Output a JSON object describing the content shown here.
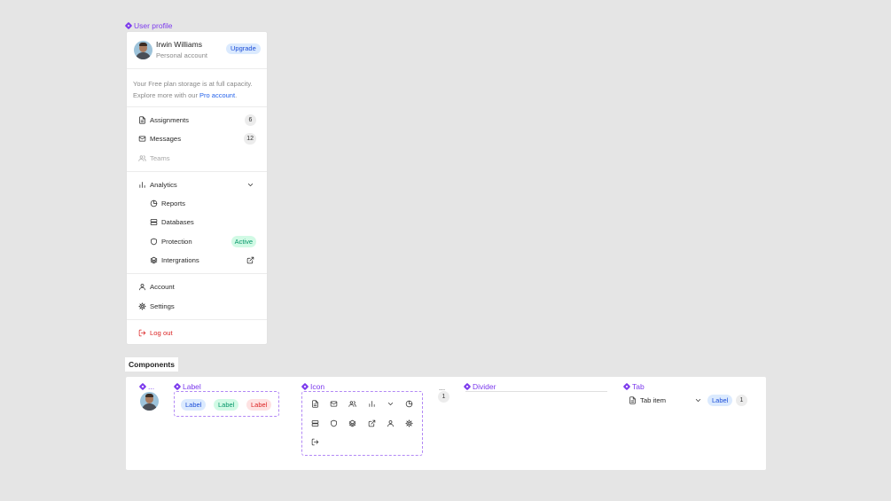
{
  "profile_component": {
    "tag": "User profile"
  },
  "user": {
    "name": "Irwin Williams",
    "account_type": "Personal account",
    "upgrade_label": "Upgrade"
  },
  "notice": {
    "text": "Your Free plan storage is at full capacity. Explore more with our ",
    "link": "Pro account",
    "end": "."
  },
  "nav": {
    "assignments": {
      "label": "Assignments",
      "count": "6",
      "icon": "document-icon"
    },
    "messages": {
      "label": "Messages",
      "count": "12",
      "icon": "mail-icon"
    },
    "teams": {
      "label": "Teams",
      "icon": "users-icon",
      "state": "disabled"
    }
  },
  "analytics": {
    "label": "Analytics",
    "icon": "bar-chart-icon",
    "expanded": true,
    "items": [
      {
        "label": "Reports",
        "icon": "pie-chart-icon"
      },
      {
        "label": "Databases",
        "icon": "database-icon"
      },
      {
        "label": "Protection",
        "icon": "shield-icon",
        "badge": "Active"
      },
      {
        "label": "Intergrations",
        "icon": "layers-icon",
        "trail_icon": "external-link-icon"
      }
    ]
  },
  "account_menu": {
    "account": {
      "label": "Account",
      "icon": "user-icon"
    },
    "settings": {
      "label": "Settings",
      "icon": "gear-icon"
    }
  },
  "logout": {
    "label": "Log out",
    "icon": "logout-icon"
  },
  "components": {
    "title": "Components",
    "avatar_tag": "...",
    "label_tag": "Label",
    "labels": [
      "Label",
      "Label",
      "Label"
    ],
    "icon_tag": "Icon",
    "icon_set": [
      "document-icon",
      "mail-icon",
      "users-icon",
      "bar-chart-icon",
      "chevron-down-icon",
      "pie-chart-icon",
      "database-icon",
      "shield-icon",
      "layers-icon",
      "external-link-icon",
      "user-icon",
      "gear-icon",
      "logout-icon"
    ],
    "count_tag": "...",
    "count_value": "1",
    "divider_tag": "Divider",
    "tab_tag": "Tab",
    "tab": {
      "label": "Tab item",
      "pill": "Label",
      "count": "1"
    }
  },
  "colors": {
    "accent": "#7c3aed",
    "link": "#2563eb",
    "success": "#059669",
    "danger": "#dc2626"
  }
}
